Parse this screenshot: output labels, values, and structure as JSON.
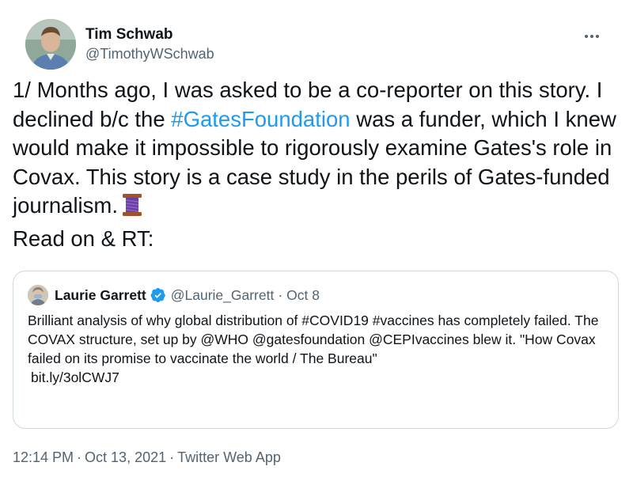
{
  "author": {
    "name": "Tim Schwab",
    "handle": "@TimothyWSchwab",
    "avatar_icon": "profile-photo"
  },
  "tweet": {
    "text_part1": "1/ Months ago, I was asked to be a co-reporter on this story. I declined b/c the ",
    "hashtag": "#GatesFoundation",
    "text_part2": " was a funder, which I knew would make it impossible to rigorously examine Gates's role in Covax. This story is a case study in the perils of Gates-funded journalism.",
    "emoji": "thread-spool",
    "text_part3": "Read on & RT:"
  },
  "quoted": {
    "name": "Laurie Garrett",
    "verified_icon": "verified-badge",
    "handle": "@Laurie_Garrett",
    "separator": "·",
    "date": "Oct 8",
    "text": "Brilliant analysis of why global distribution of #COVID19 #vaccines has completely failed. The COVAX structure, set up by @WHO @gatesfoundation @CEPIvaccines blew it. \"How Covax failed on its promise to vaccinate the world / The Bureau\"",
    "link": "bit.ly/3olCWJ7"
  },
  "meta": {
    "time": "12:14 PM",
    "separator": "·",
    "date": "Oct 13, 2021",
    "source": "Twitter Web App"
  },
  "colors": {
    "accent": "#1d9bf0",
    "secondary_text": "#536471",
    "border": "#cfd9de"
  }
}
